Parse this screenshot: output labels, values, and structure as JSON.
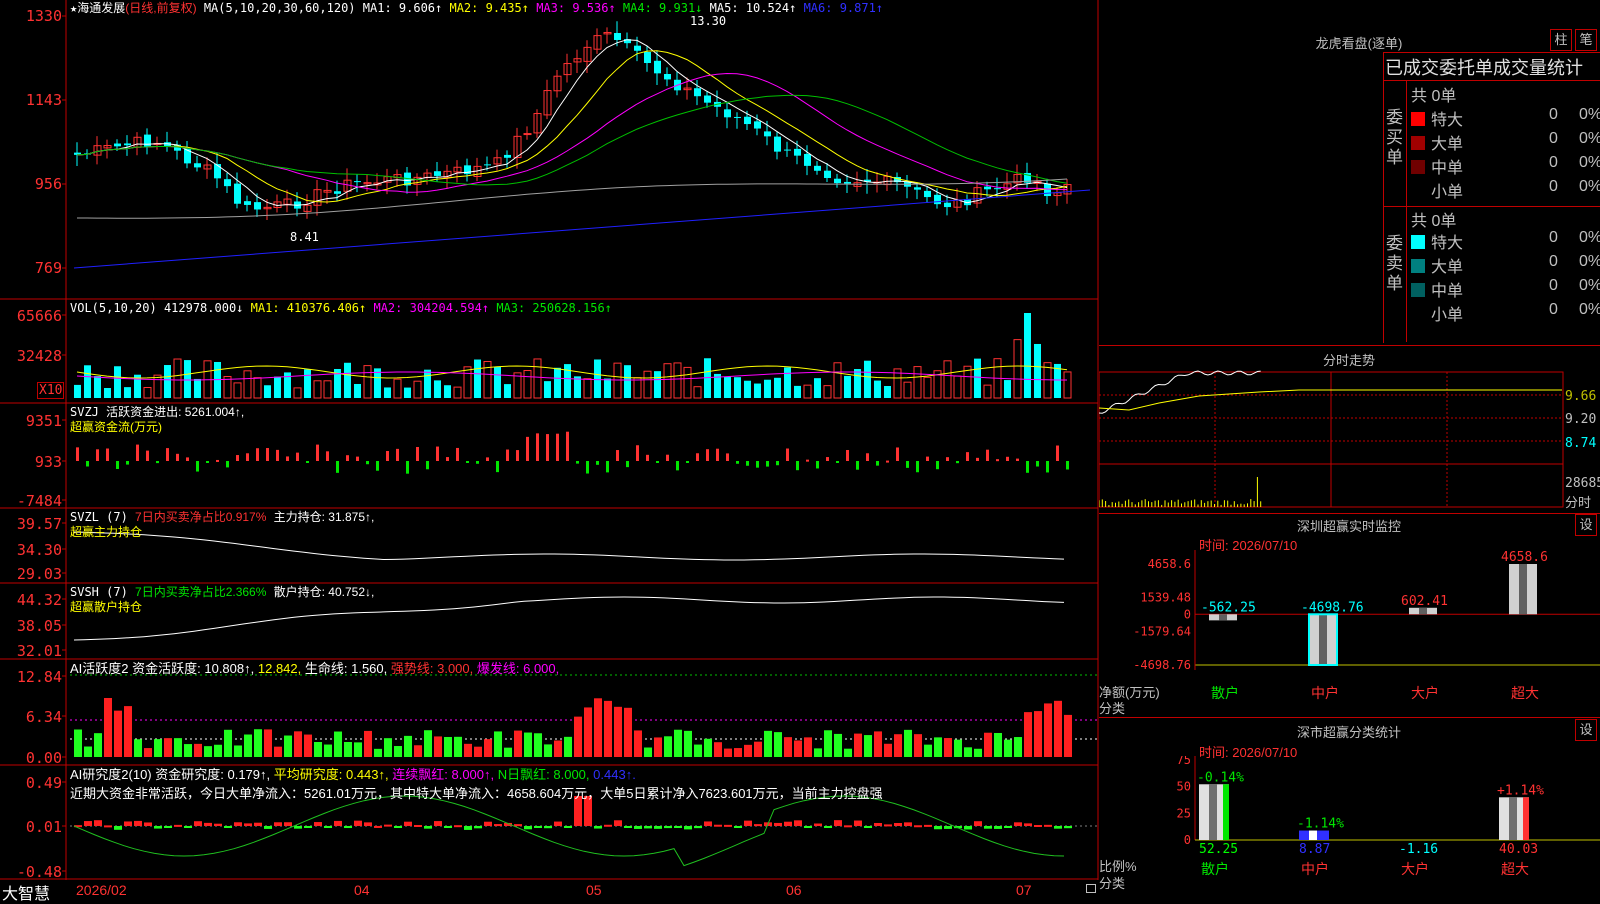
{
  "stock": {
    "name": "海通发展",
    "mode": "(日线,前复权)",
    "ma_label": "MA(5,10,20,30,60,120)",
    "ma1": "MA1: 9.606↑",
    "ma2": "MA2: 9.435↑",
    "ma3": "MA3: 9.536↑",
    "ma4": "MA4: 9.931↓",
    "ma5": "MA5: 10.524↑",
    "ma6": "MA6: 9.871↑",
    "high_mark": "13.30",
    "low_mark": "8.41",
    "star": "★"
  },
  "price_axis": [
    "1330",
    "1143",
    "956",
    "769"
  ],
  "vol": {
    "label": "VOL(5,10,20)",
    "value": "412978.000↓",
    "ma1": "MA1: 410376.406↑",
    "ma2": "MA2: 304204.594↑",
    "ma3": "MA3: 250628.156↑",
    "axis": [
      "65666",
      "32428"
    ],
    "unit": "X10"
  },
  "svzj": {
    "label": "SVZJ",
    "text": "活跃资金进出: 5261.004↑,",
    "sub": "超赢资金流(万元)",
    "axis": [
      "9351",
      "933",
      "-7484"
    ]
  },
  "svzl": {
    "label": "SVZL (7)",
    "text1": "7日内买卖净占比0.917%",
    "text2": "主力持仓: 31.875↑,",
    "sub": "超赢主力持仓",
    "axis": [
      "39.57",
      "34.30",
      "29.03"
    ]
  },
  "svsh": {
    "label": "SVSH (7)",
    "text1": "7日内买卖净占比2.366%",
    "text2": "散户持仓: 40.752↓,",
    "sub": "超赢散户持仓",
    "axis": [
      "44.32",
      "38.05",
      "32.01"
    ]
  },
  "ai1": {
    "label": "AI活跃度2",
    "t1": "资金活跃度: 10.808↑,",
    "t2": "12.842,",
    "t3": "生命线: 1.560,",
    "t4": "强势线: 3.000,",
    "t5": "爆发线: 6.000,",
    "axis": [
      "12.84",
      "6.34",
      "0.00"
    ]
  },
  "ai2": {
    "label": "AI研究度2(10)",
    "t1": "资金研究度: 0.179↑,",
    "t2": "平均研究度: 0.443↑,",
    "t3": "连续飘红: 8.000↑,",
    "t4": "N日飘红: 8.000,",
    "t5": "0.443↑.",
    "desc": "近期大资金非常活跃，今日大单净流入：5261.01万元，其中特大单净流入：4658.604万元，大单5日累计净入7623.601万元，当前主力控盘强",
    "axis": [
      "0.49",
      "0.01",
      "-0.48"
    ]
  },
  "bottom": {
    "brand": "大智慧",
    "dates": [
      "2026/02",
      "04",
      "05",
      "06",
      "07"
    ]
  },
  "lhb": {
    "title": "龙虎看盘(逐单)",
    "btn1": "柱",
    "btn2": "笔",
    "header": "已成交委托单成交量统计",
    "buy_side": "委买单",
    "sell_side": "委卖单",
    "buy_total": "共 0单",
    "sell_total": "共 0单",
    "buy_rows": [
      {
        "label": "特大",
        "count": "0",
        "pct": "0%",
        "color": "#ff0000"
      },
      {
        "label": "大单",
        "count": "0",
        "pct": "0%",
        "color": "#a00000"
      },
      {
        "label": "中单",
        "count": "0",
        "pct": "0%",
        "color": "#700000"
      },
      {
        "label": "小单",
        "count": "0",
        "pct": "0%",
        "color": "#000000"
      }
    ],
    "sell_rows": [
      {
        "label": "特大",
        "count": "0",
        "pct": "0%",
        "color": "#00ffff"
      },
      {
        "label": "大单",
        "count": "0",
        "pct": "0%",
        "color": "#008080"
      },
      {
        "label": "中单",
        "count": "0",
        "pct": "0%",
        "color": "#006060"
      },
      {
        "label": "小单",
        "count": "0",
        "pct": "0%",
        "color": "#000000"
      }
    ]
  },
  "intraday": {
    "title": "分时走势",
    "axis": [
      "9.66",
      "9.20",
      "8.74"
    ],
    "vol_label": "28685",
    "vol_unit": "分时"
  },
  "sz_monitor": {
    "title": "深圳超赢实时监控",
    "btn": "设",
    "time": "时间: 2026/07/10",
    "axis": [
      "4658.6",
      "1539.48",
      "0",
      "-1579.64",
      "-4698.76"
    ],
    "ylabel1": "净额(万元)",
    "ylabel2": "分类",
    "categories": [
      "散户",
      "中户",
      "大户",
      "超大"
    ],
    "values": [
      -562.25,
      -4698.76,
      602.41,
      4658.6
    ],
    "value_labels": [
      "-562.25",
      "-4698.76",
      "602.41",
      "4658.6"
    ]
  },
  "sz_class": {
    "title": "深市超赢分类统计",
    "btn": "设",
    "time": "时间: 2026/07/10",
    "axis": [
      "75",
      "50",
      "25",
      "0"
    ],
    "ylabel1": "比例%",
    "ylabel2": "分类",
    "categories": [
      "散户",
      "中户",
      "大户",
      "超大"
    ],
    "values": [
      52.25,
      8.87,
      -1.16,
      40.03
    ],
    "value_labels": [
      "52.25",
      "8.87",
      "-1.16",
      "40.03"
    ],
    "change_labels": [
      "-0.14%",
      "-1.14%",
      "",
      "+1.14%"
    ]
  },
  "colors": {
    "up": "#ff3232",
    "down": "#00ffff",
    "grid": "#c00000"
  }
}
